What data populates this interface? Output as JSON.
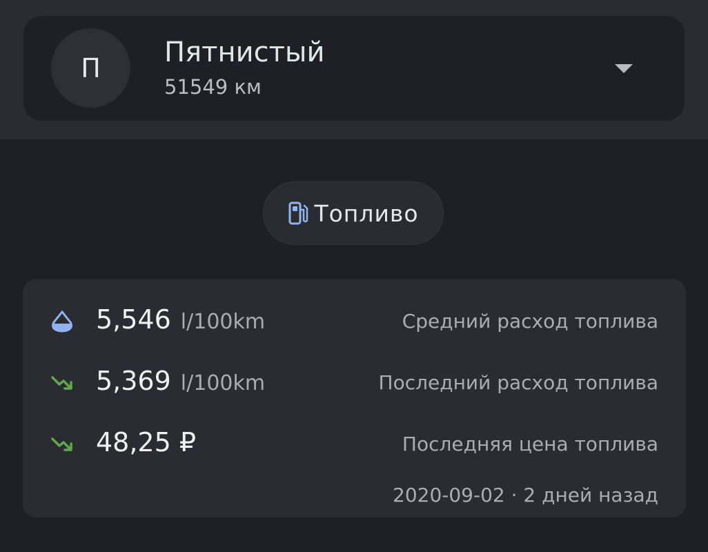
{
  "vehicle": {
    "avatar_letter": "П",
    "name": "Пятнистый",
    "mileage": "51549 км"
  },
  "category_chip": {
    "label": "Топливо",
    "icon": "fuel-pump-icon"
  },
  "stats": [
    {
      "icon": "drop-icon",
      "value": "5,546",
      "unit": "l/100km",
      "label": "Средний расход топлива"
    },
    {
      "icon": "trend-down-icon",
      "value": "5,369",
      "unit": "l/100km",
      "label": "Последний расход топлива"
    },
    {
      "icon": "trend-down-icon",
      "value": "48,25 ₽",
      "unit": "",
      "label": "Последняя цена топлива"
    }
  ],
  "last_update": "2020-09-02 · 2 дней назад",
  "colors": {
    "accent_blue": "#8fb4f0",
    "trend_green": "#5fa84c"
  }
}
